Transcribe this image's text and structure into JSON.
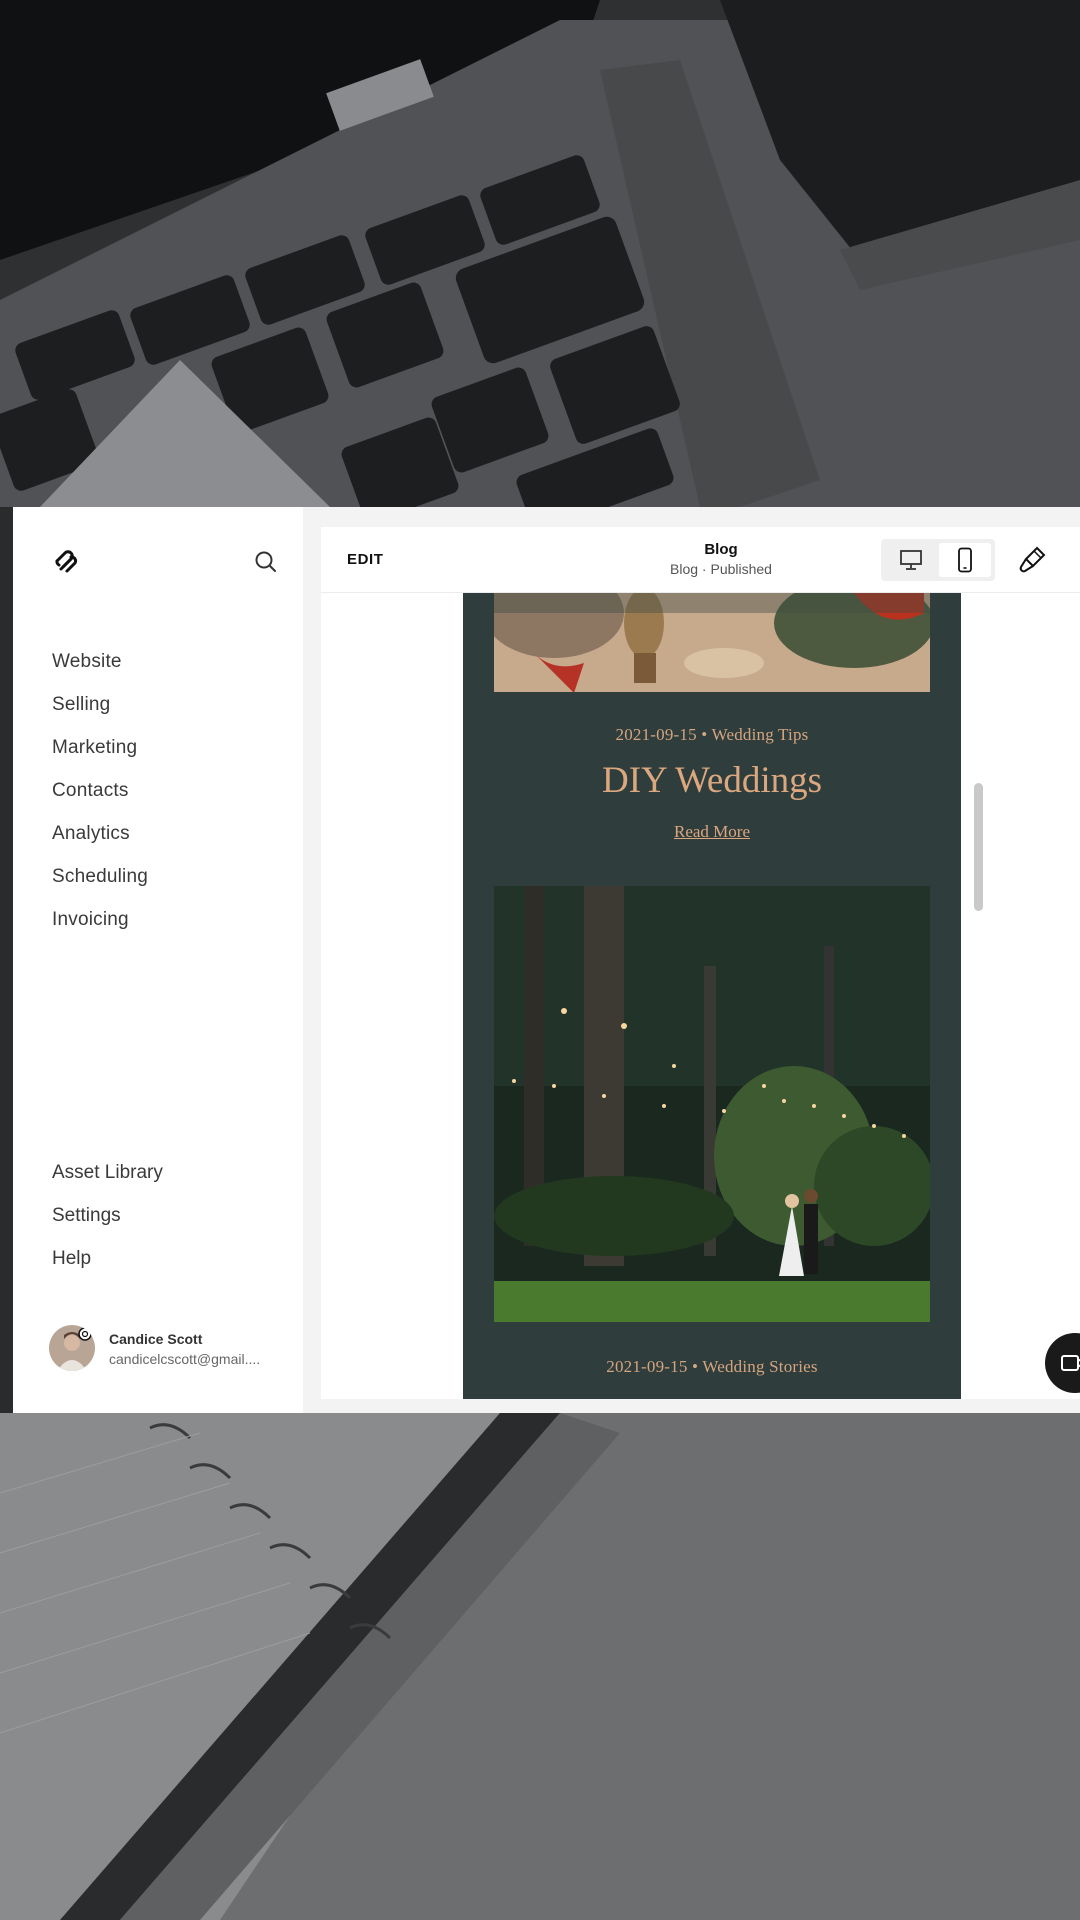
{
  "sidebar": {
    "nav_items": [
      {
        "label": "Website"
      },
      {
        "label": "Selling"
      },
      {
        "label": "Marketing"
      },
      {
        "label": "Contacts"
      },
      {
        "label": "Analytics"
      },
      {
        "label": "Scheduling"
      },
      {
        "label": "Invoicing"
      }
    ],
    "bottom_items": [
      {
        "label": "Asset Library"
      },
      {
        "label": "Settings"
      },
      {
        "label": "Help"
      }
    ],
    "user": {
      "name": "Candice Scott",
      "email": "candicelcscott@gmail...."
    }
  },
  "toolbar": {
    "edit_label": "EDIT",
    "page_title": "Blog",
    "page_status": "Blog · Published",
    "active_device": "mobile"
  },
  "preview": {
    "post1": {
      "meta": "2021-09-15  •  Wedding Tips",
      "title": "DIY Weddings",
      "read_more": "Read More"
    },
    "post2": {
      "meta": "2021-09-15  •  Wedding Stories"
    }
  },
  "colors": {
    "preview_bg": "#2f3d3d",
    "accent": "#dba77f",
    "sidebar_text": "#3a3a3a"
  },
  "icons": {
    "logo": "squarespace-logo-icon",
    "search": "search-icon",
    "desktop": "desktop-icon",
    "mobile": "mobile-icon",
    "brush": "brush-icon",
    "video": "video-camera-icon"
  }
}
